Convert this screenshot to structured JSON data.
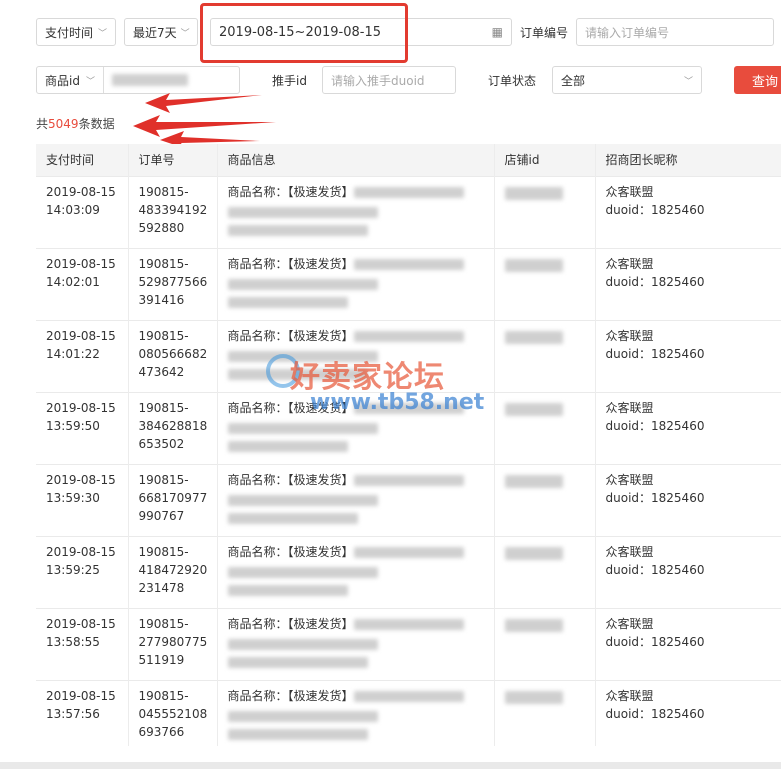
{
  "filters": {
    "time_type": "支付时间",
    "time_range": "最近7天",
    "date_range": "2019-08-15~2019-08-15",
    "order_no_label": "订单编号",
    "order_no_placeholder": "请输入订单编号",
    "goods_field": "商品id",
    "promoter_label": "推手id",
    "promoter_placeholder": "请输入推手duoid",
    "status_label": "订单状态",
    "status_value": "全部",
    "query_label": "查询"
  },
  "summary": {
    "prefix": "共",
    "count": "5049",
    "suffix": "条数据"
  },
  "table": {
    "headers": [
      "支付时间",
      "订单号",
      "商品信息",
      "店铺id",
      "招商团长昵称"
    ],
    "product_prefix": "商品名称：【极速发货】",
    "rows": [
      {
        "date": "2019-08-15",
        "time": "14:03:09",
        "order": [
          "190815-",
          "483394192",
          "592880"
        ],
        "leader": "众客联盟",
        "duoid": "duoid：1825460"
      },
      {
        "date": "2019-08-15",
        "time": "14:02:01",
        "order": [
          "190815-",
          "529877566",
          "391416"
        ],
        "leader": "众客联盟",
        "duoid": "duoid：1825460"
      },
      {
        "date": "2019-08-15",
        "time": "14:01:22",
        "order": [
          "190815-",
          "080566682",
          "473642"
        ],
        "leader": "众客联盟",
        "duoid": "duoid：1825460"
      },
      {
        "date": "2019-08-15",
        "time": "13:59:50",
        "order": [
          "190815-",
          "384628818",
          "653502"
        ],
        "leader": "众客联盟",
        "duoid": "duoid：1825460"
      },
      {
        "date": "2019-08-15",
        "time": "13:59:30",
        "order": [
          "190815-",
          "668170977",
          "990767"
        ],
        "leader": "众客联盟",
        "duoid": "duoid：1825460"
      },
      {
        "date": "2019-08-15",
        "time": "13:59:25",
        "order": [
          "190815-",
          "418472920",
          "231478"
        ],
        "leader": "众客联盟",
        "duoid": "duoid：1825460"
      },
      {
        "date": "2019-08-15",
        "time": "13:58:55",
        "order": [
          "190815-",
          "277980775",
          "511919"
        ],
        "leader": "众客联盟",
        "duoid": "duoid：1825460"
      },
      {
        "date": "2019-08-15",
        "time": "13:57:56",
        "order": [
          "190815-",
          "045552108",
          "693766"
        ],
        "leader": "众客联盟",
        "duoid": "duoid：1825460"
      }
    ]
  },
  "watermark": {
    "main": "好卖家论坛",
    "url": "www.tb58.net"
  },
  "colors": {
    "accent": "#e84c3d",
    "highlight": "#e23b30",
    "arrow": "#e0302a"
  }
}
